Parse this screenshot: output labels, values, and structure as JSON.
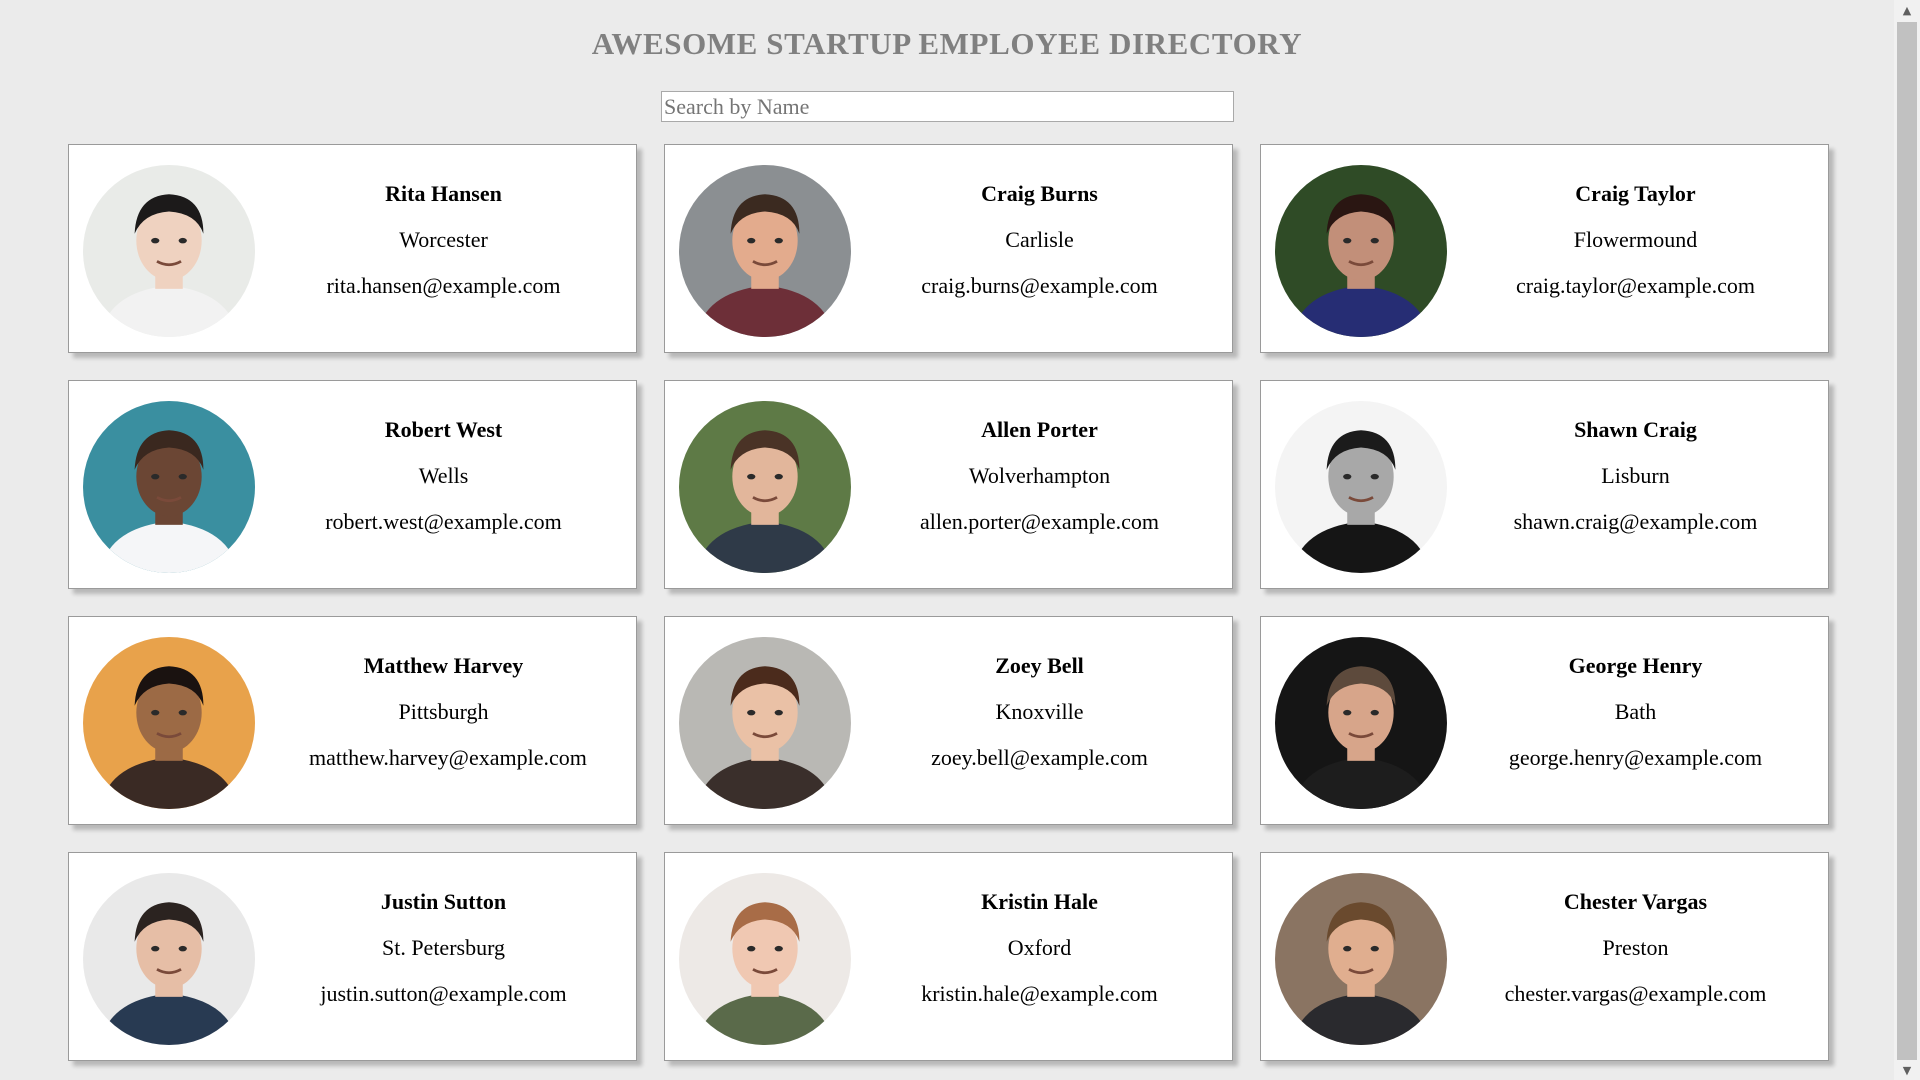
{
  "header": {
    "title": "AWESOME STARTUP EMPLOYEE DIRECTORY"
  },
  "search": {
    "placeholder": "Search by Name",
    "value": ""
  },
  "employees": [
    {
      "name": "Rita Hansen",
      "city": "Worcester",
      "email": "rita.hansen@example.com",
      "avatar": {
        "bg": "#e9ebe8",
        "skin": "#efd2c0",
        "hair": "#1c1a1a",
        "shirt": "#f2f2f2"
      }
    },
    {
      "name": "Craig Burns",
      "city": "Carlisle",
      "email": "craig.burns@example.com",
      "avatar": {
        "bg": "#8b8f92",
        "skin": "#e3ab8d",
        "hair": "#3b2a20",
        "shirt": "#6d2f38"
      }
    },
    {
      "name": "Craig Taylor",
      "city": "Flowermound",
      "email": "craig.taylor@example.com",
      "avatar": {
        "bg": "#2f4b26",
        "skin": "#c28f79",
        "hair": "#2a1612",
        "shirt": "#262d74"
      }
    },
    {
      "name": "Robert West",
      "city": "Wells",
      "email": "robert.west@example.com",
      "avatar": {
        "bg": "#3a8fa0",
        "skin": "#6b4634",
        "hair": "#3a281f",
        "shirt": "#f5f6f8"
      }
    },
    {
      "name": "Allen Porter",
      "city": "Wolverhampton",
      "email": "allen.porter@example.com",
      "avatar": {
        "bg": "#5e7a46",
        "skin": "#e2b69b",
        "hair": "#4a3326",
        "shirt": "#2f3a48"
      }
    },
    {
      "name": "Shawn Craig",
      "city": "Lisburn",
      "email": "shawn.craig@example.com",
      "avatar": {
        "bg": "#f4f4f4",
        "skin": "#a8a8a8",
        "hair": "#1b1b1b",
        "shirt": "#151515"
      }
    },
    {
      "name": "Matthew Harvey",
      "city": "Pittsburgh",
      "email": "matthew.harvey@example.com",
      "avatar": {
        "bg": "#e8a24b",
        "skin": "#9c6a45",
        "hair": "#1a1210",
        "shirt": "#3a2a24"
      }
    },
    {
      "name": "Zoey Bell",
      "city": "Knoxville",
      "email": "zoey.bell@example.com",
      "avatar": {
        "bg": "#b9b8b4",
        "skin": "#eac1a6",
        "hair": "#4b2b1c",
        "shirt": "#3a2f2b"
      }
    },
    {
      "name": "George Henry",
      "city": "Bath",
      "email": "george.henry@example.com",
      "avatar": {
        "bg": "#151515",
        "skin": "#d7a58a",
        "hair": "#5d4a3c",
        "shirt": "#1d1d1d"
      }
    },
    {
      "name": "Justin Sutton",
      "city": "St. Petersburg",
      "email": "justin.sutton@example.com",
      "avatar": {
        "bg": "#e9e9e9",
        "skin": "#e6bea6",
        "hair": "#2b2320",
        "shirt": "#283a52"
      }
    },
    {
      "name": "Kristin Hale",
      "city": "Oxford",
      "email": "kristin.hale@example.com",
      "avatar": {
        "bg": "#ede9e6",
        "skin": "#f0c8b2",
        "hair": "#a86c47",
        "shirt": "#5a6a4a"
      }
    },
    {
      "name": "Chester Vargas",
      "city": "Preston",
      "email": "chester.vargas@example.com",
      "avatar": {
        "bg": "#8a7462",
        "skin": "#e0ae8f",
        "hair": "#6a4a2e",
        "shirt": "#2a2a2e"
      }
    }
  ]
}
